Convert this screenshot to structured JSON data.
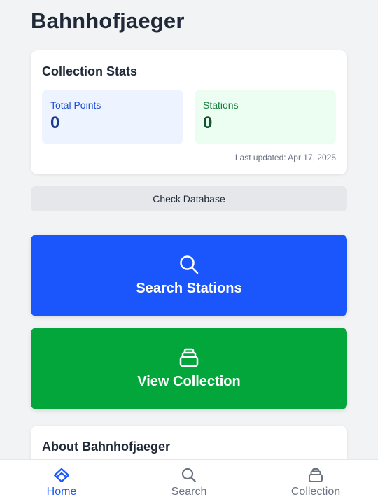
{
  "app": {
    "title": "Bahnhofjaeger"
  },
  "stats": {
    "title": "Collection Stats",
    "total_points_label": "Total Points",
    "total_points_value": "0",
    "stations_label": "Stations",
    "stations_value": "0",
    "last_updated": "Last updated: Apr 17, 2025"
  },
  "actions": {
    "check_database": "Check Database",
    "search_stations": "Search Stations",
    "view_collection": "View Collection"
  },
  "about": {
    "title": "About Bahnhofjaeger"
  },
  "tabs": [
    {
      "label": "Home",
      "icon": "home-icon",
      "active": true
    },
    {
      "label": "Search",
      "icon": "search-icon",
      "active": false
    },
    {
      "label": "Collection",
      "icon": "collection-icon",
      "active": false
    }
  ],
  "colors": {
    "primary": "#1a56fb",
    "success": "#03a63a",
    "background": "#f2f3f5"
  }
}
